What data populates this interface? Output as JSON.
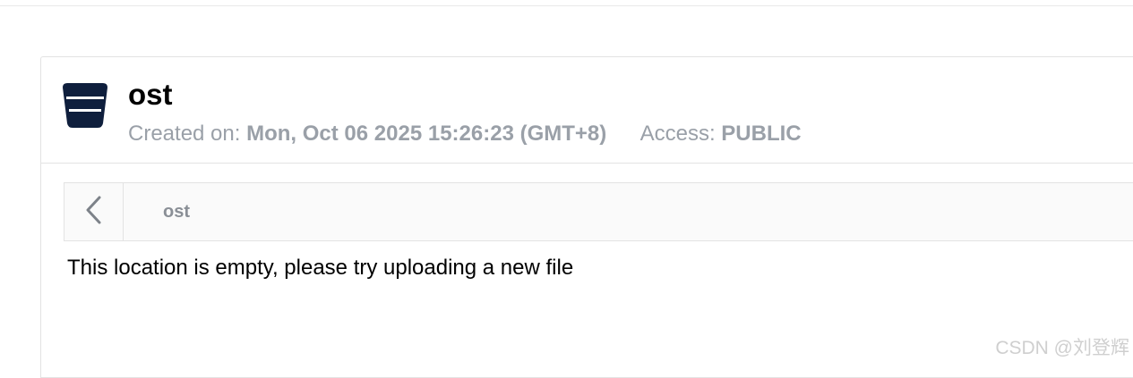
{
  "bucket": {
    "name": "ost",
    "icon": "bucket-icon",
    "created_label": "Created on:",
    "created_value": "Mon, Oct 06 2025 15:26:23 (GMT+8)",
    "access_label": "Access:",
    "access_value": "PUBLIC"
  },
  "browser": {
    "back_icon": "chevron-left-icon",
    "current_path": "ost",
    "empty_message": "This location is empty, please try uploading a new file"
  },
  "watermark": "CSDN @刘登辉",
  "colors": {
    "icon": "#0f1f3d",
    "muted_text": "#9aa0a8",
    "border": "#e3e3e3"
  }
}
